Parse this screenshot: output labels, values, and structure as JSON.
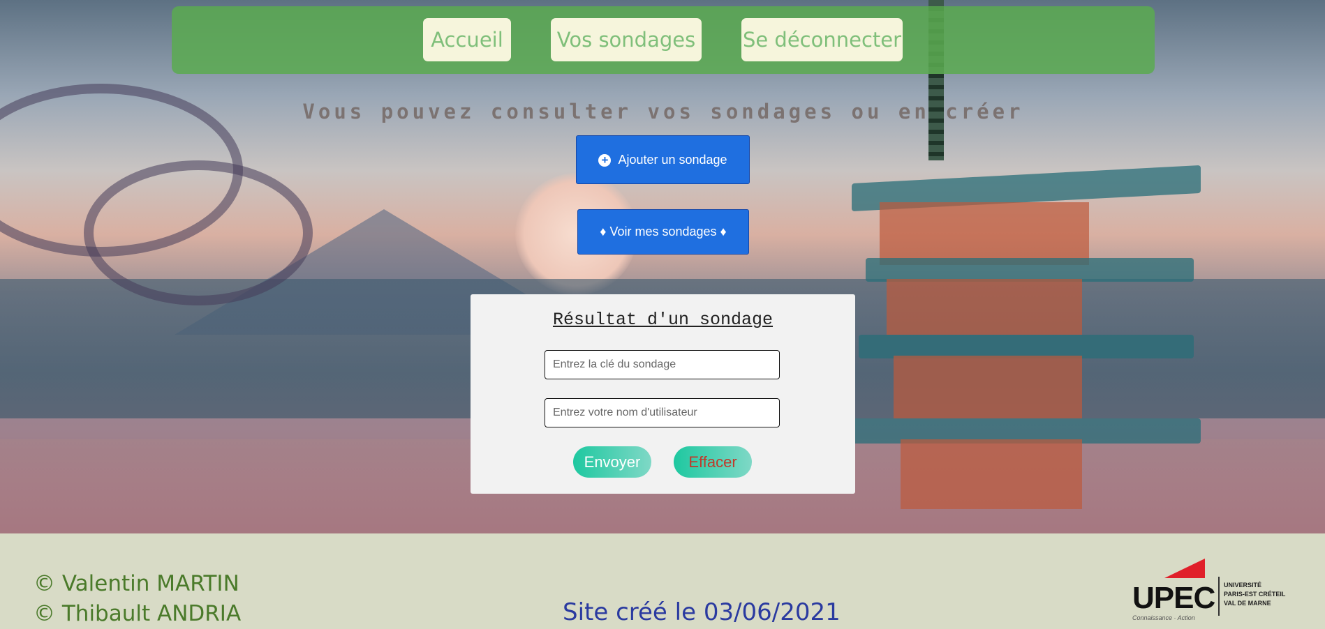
{
  "nav": {
    "home_label": "Accueil",
    "surveys_label": "Vos sondages",
    "logout_label": "Se déconnecter"
  },
  "heading": "Vous pouvez consulter vos sondages ou en créer",
  "actions": {
    "add_survey_label": "Ajouter un sondage",
    "view_surveys_label": "♦ Voir mes sondages ♦"
  },
  "result_form": {
    "title": "Résultat d'un sondage",
    "key_placeholder": "Entrez la clé du sondage",
    "key_value": "",
    "username_placeholder": "Entrez votre nom d'utilisateur",
    "username_value": "",
    "submit_label": "Envoyer",
    "clear_label": "Effacer"
  },
  "footer": {
    "credit_1": "© Valentin MARTIN",
    "credit_2": "© Thibault ANDRIA",
    "created": "Site créé le 03/06/2021",
    "logo": {
      "word": "UPEC",
      "line_1": "UNIVERSITÉ",
      "line_2": "PARIS-EST CRÉTEIL",
      "line_3": "VAL DE MARNE",
      "tagline": "Connaissance · Action"
    }
  },
  "colors": {
    "navbar": "#5aaa50",
    "nav_button_bg": "#f6f5dc",
    "nav_button_text": "#7fbf7a",
    "primary_button": "#1f6fe0",
    "pill_button": "#1ec8a0",
    "submit_text": "#ffffff",
    "clear_text": "#c0392b"
  }
}
